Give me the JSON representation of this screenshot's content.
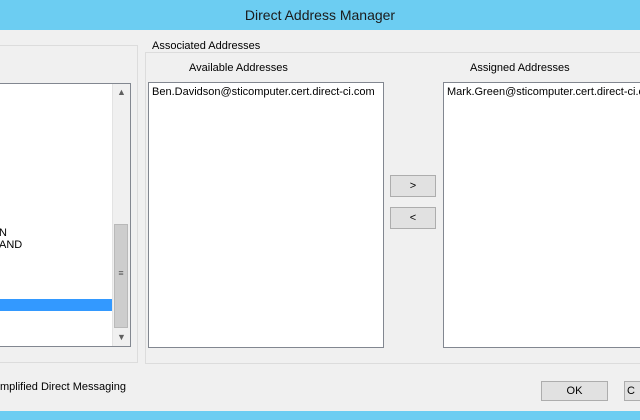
{
  "window": {
    "title": "Direct Address Manager"
  },
  "left_panel": {
    "fragments": [
      "N",
      "AND"
    ],
    "scrollbar": {
      "up_glyph": "▲",
      "down_glyph": "▼",
      "grip_glyph": "≡"
    }
  },
  "associated": {
    "group_title": "Associated Addresses",
    "available": {
      "label": "Available Addresses",
      "items": [
        "Ben.Davidson@sticomputer.cert.direct-ci.com"
      ]
    },
    "assigned": {
      "label": "Assigned Addresses",
      "items": [
        "Mark.Green@sticomputer.cert.direct-ci.com"
      ]
    },
    "move_right_label": ">",
    "move_left_label": "<"
  },
  "footer": {
    "checkbox_label_fragment": "mplified Direct Messaging",
    "ok_label": "OK",
    "cancel_label": "C"
  },
  "colors": {
    "titlebar": "#6ccdf2",
    "selection": "#3399ff"
  }
}
